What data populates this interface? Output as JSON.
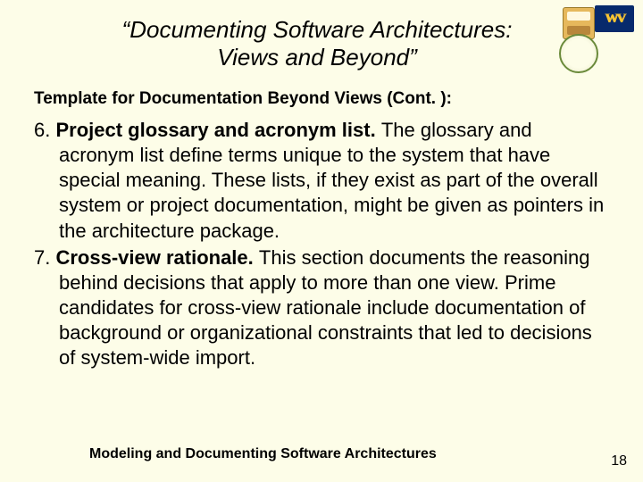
{
  "title": "“Documenting Software Architectures: Views and Beyond”",
  "subtitle": "Template for Documentation Beyond Views (Cont. ):",
  "items": [
    {
      "num": "6. ",
      "lead": "Project glossary and acronym list. ",
      "rest": "The glossary and acronym list define terms unique to the system that have special meaning. These lists, if they exist as part of the overall system or project documentation, might be given as pointers in the architecture package."
    },
    {
      "num": "7. ",
      "lead": "Cross-view rationale. ",
      "rest": "This section documents the reasoning behind decisions that apply to more than one view. Prime candidates for cross-view rationale include documentation of background or organizational constraints that led to decisions of system-wide import."
    }
  ],
  "footer": "Modeling and Documenting Software Architectures",
  "page": "18",
  "logos": {
    "wv": "WV"
  }
}
